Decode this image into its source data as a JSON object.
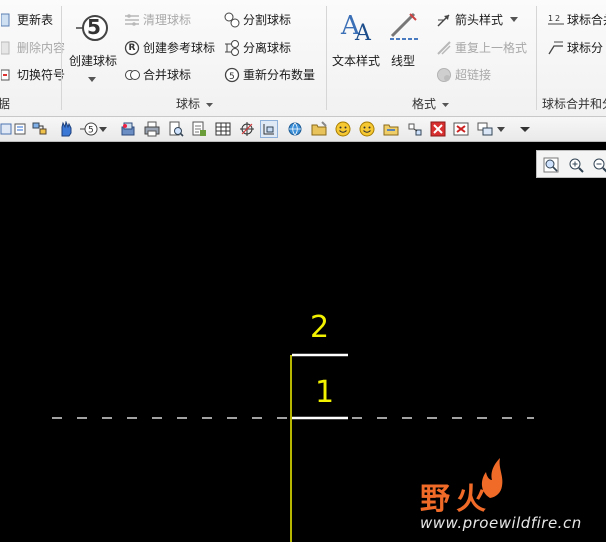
{
  "ribbon": {
    "col0": {
      "update_table": "更新表",
      "delete_content": "删除内容",
      "toggle_symbol": "切换符号",
      "group_label_partial": "据"
    },
    "balloon_group": {
      "create_balloon": "创建球标",
      "clean_balloon": "清理球标",
      "create_ref_balloon": "创建参考球标",
      "merge_balloon": "合并球标",
      "split_balloon": "分割球标",
      "detach_balloon": "分离球标",
      "redistribute_count": "重新分布数量",
      "group_label": "球标",
      "big_icon_number": "5",
      "ref_badge": "R"
    },
    "format_group": {
      "text_style": "文本样式",
      "line_type": "线型",
      "arrow_style": "箭头样式",
      "repeat_format": "重复上一格式",
      "hyperlink": "超链接",
      "group_label": "格式"
    },
    "merge_group": {
      "item1": "球标合并",
      "item2": "球标分",
      "group_label": "球标合并和分"
    }
  },
  "toolbar": {
    "icons": [
      "refit-icon",
      "repaint-icon",
      "layer-icon",
      "pan-icon",
      "balloon-icon",
      "dropdown",
      "save-icon",
      "print-icon",
      "print-preview-icon",
      "page-setup-icon",
      "table-icon",
      "measure-icon",
      "grid-icon",
      "globe-icon",
      "folder-icon",
      "smiley-icon",
      "smiley2-icon",
      "open-icon",
      "move-icon",
      "close-red-icon",
      "window-icon",
      "dropdown",
      "more-icon"
    ]
  },
  "zoom": {
    "buttons": [
      "zoom-fit-icon",
      "zoom-in-icon",
      "zoom-out-icon"
    ]
  },
  "canvas": {
    "balloon_top": "2",
    "balloon_bottom": "1",
    "watermark_title": "野火",
    "watermark_url": "www.proewildfire.cn",
    "colors": {
      "background": "#000000",
      "balloon": "#f2f200",
      "leader": "#ffffff",
      "watermark": "#f06a28"
    }
  }
}
